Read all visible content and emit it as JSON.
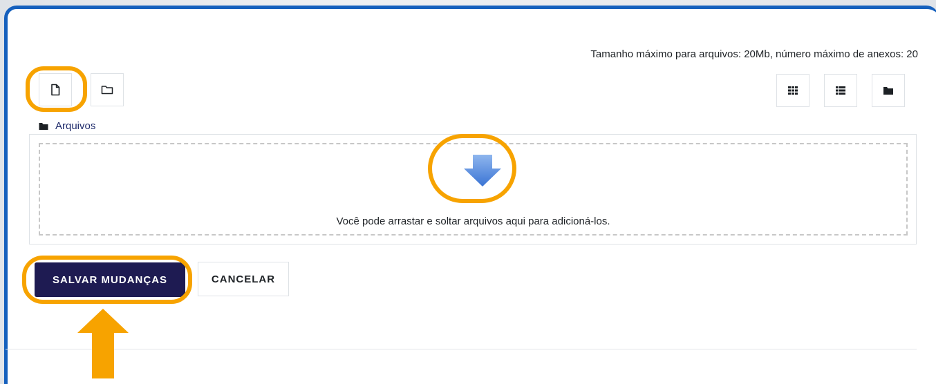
{
  "file_limits": "Tamanho máximo para arquivos: 20Mb, número máximo de anexos: 20",
  "toolbar": {
    "add_file_icon": "file-icon",
    "create_folder_icon": "folder-outline-icon",
    "view_icons_icon": "grid-icon",
    "view_list_icon": "list-icon",
    "view_tree_icon": "folder-icon"
  },
  "path": {
    "root_label": "Arquivos",
    "icon": "folder-icon"
  },
  "dropzone": {
    "message": "Você pode arrastar e soltar arquivos aqui para adicioná-los.",
    "icon": "down-arrow-icon"
  },
  "buttons": {
    "save": "SALVAR MUDANÇAS",
    "cancel": "CANCELAR"
  },
  "colors": {
    "highlight": "#f7a300",
    "primary": "#1e1b52",
    "frame": "#1560bd",
    "link": "#1f2b6b"
  }
}
